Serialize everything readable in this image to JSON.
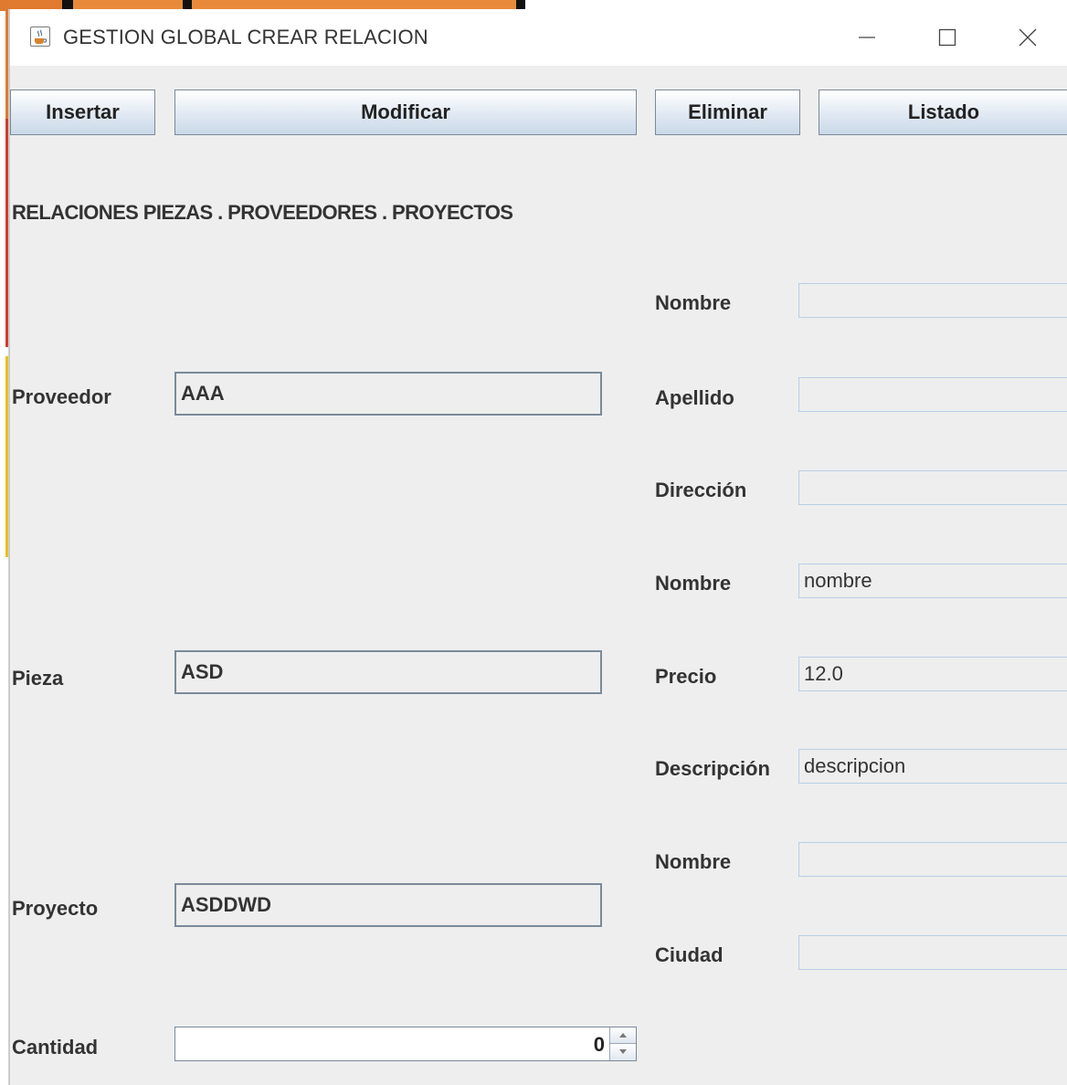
{
  "window": {
    "title": "GESTION GLOBAL CREAR RELACION"
  },
  "toolbar": {
    "insert_label": "Insertar",
    "modify_label": "Modificar",
    "delete_label": "Eliminar",
    "list_label": "Listado"
  },
  "section": {
    "heading": "RELACIONES PIEZAS . PROVEEDORES . PROYECTOS"
  },
  "left_form": {
    "proveedor_label": "Proveedor",
    "proveedor_value": "AAA",
    "pieza_label": "Pieza",
    "pieza_value": "ASD",
    "proyecto_label": "Proyecto",
    "proyecto_value": "ASDDWD",
    "cantidad_label": "Cantidad",
    "cantidad_value": "0"
  },
  "right_form": {
    "proveedor_nombre_label": "Nombre",
    "proveedor_nombre_value": "",
    "proveedor_apellido_label": "Apellido",
    "proveedor_apellido_value": "",
    "proveedor_direccion_label": "Dirección",
    "proveedor_direccion_value": "",
    "pieza_nombre_label": "Nombre",
    "pieza_nombre_value": "nombre",
    "pieza_precio_label": "Precio",
    "pieza_precio_value": "12.0",
    "pieza_descripcion_label": "Descripción",
    "pieza_descripcion_value": "descripcion",
    "proyecto_nombre_label": "Nombre",
    "proyecto_nombre_value": "",
    "proyecto_ciudad_label": "Ciudad",
    "proyecto_ciudad_value": ""
  },
  "icons": {
    "app": "java-cup-icon",
    "minimize": "minimize-icon",
    "maximize": "maximize-icon",
    "close": "close-icon"
  },
  "colors": {
    "background_strip": "#e07a2e",
    "edge_red": "#d23a2a",
    "edge_yellow": "#e8c21a",
    "field_border": "#7a8a99",
    "input_border": "#b8cfe5"
  }
}
